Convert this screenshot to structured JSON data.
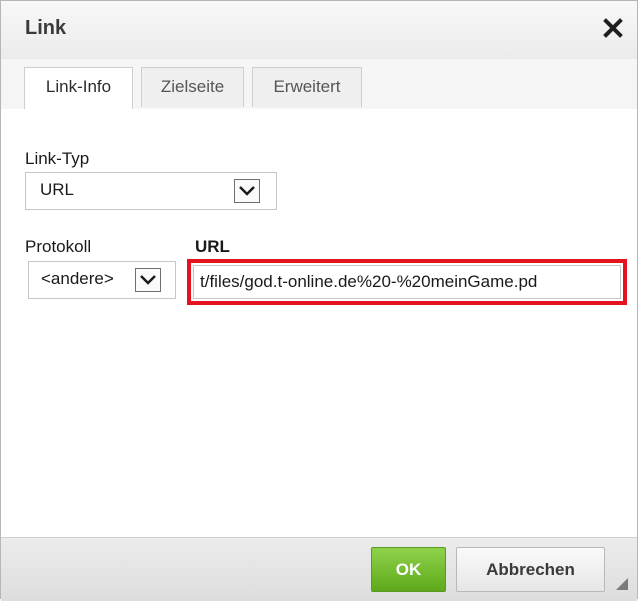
{
  "dialog": {
    "title": "Link",
    "close_icon": "close-icon"
  },
  "tabs": [
    {
      "label": "Link-Info",
      "active": true
    },
    {
      "label": "Zielseite",
      "active": false
    },
    {
      "label": "Erweitert",
      "active": false
    }
  ],
  "form": {
    "link_type_label": "Link-Typ",
    "link_type_value": "URL",
    "protocol_label": "Protokoll",
    "protocol_value": "<andere>",
    "url_label": "URL",
    "url_value": "t/files/god.t-online.de%20-%20meinGame.pd",
    "highlight_color": "#e3141d"
  },
  "footer": {
    "ok_label": "OK",
    "cancel_label": "Abbrechen",
    "ok_color": "#6ab425"
  }
}
